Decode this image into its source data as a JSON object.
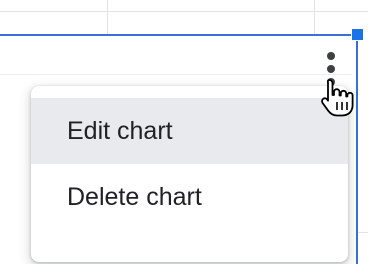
{
  "sheet": {
    "grid_color": "#e3e3e3"
  },
  "chart": {
    "selection_color": "#3b6fd8",
    "handle_color": "#1a73e8"
  },
  "kebab_menu": {
    "icon": "more-vert-icon"
  },
  "cursor": {
    "icon": "hand-pointer-icon"
  },
  "context_menu": {
    "items": [
      {
        "label": "Edit chart",
        "highlighted": true
      },
      {
        "label": "Delete chart",
        "highlighted": false
      }
    ]
  }
}
